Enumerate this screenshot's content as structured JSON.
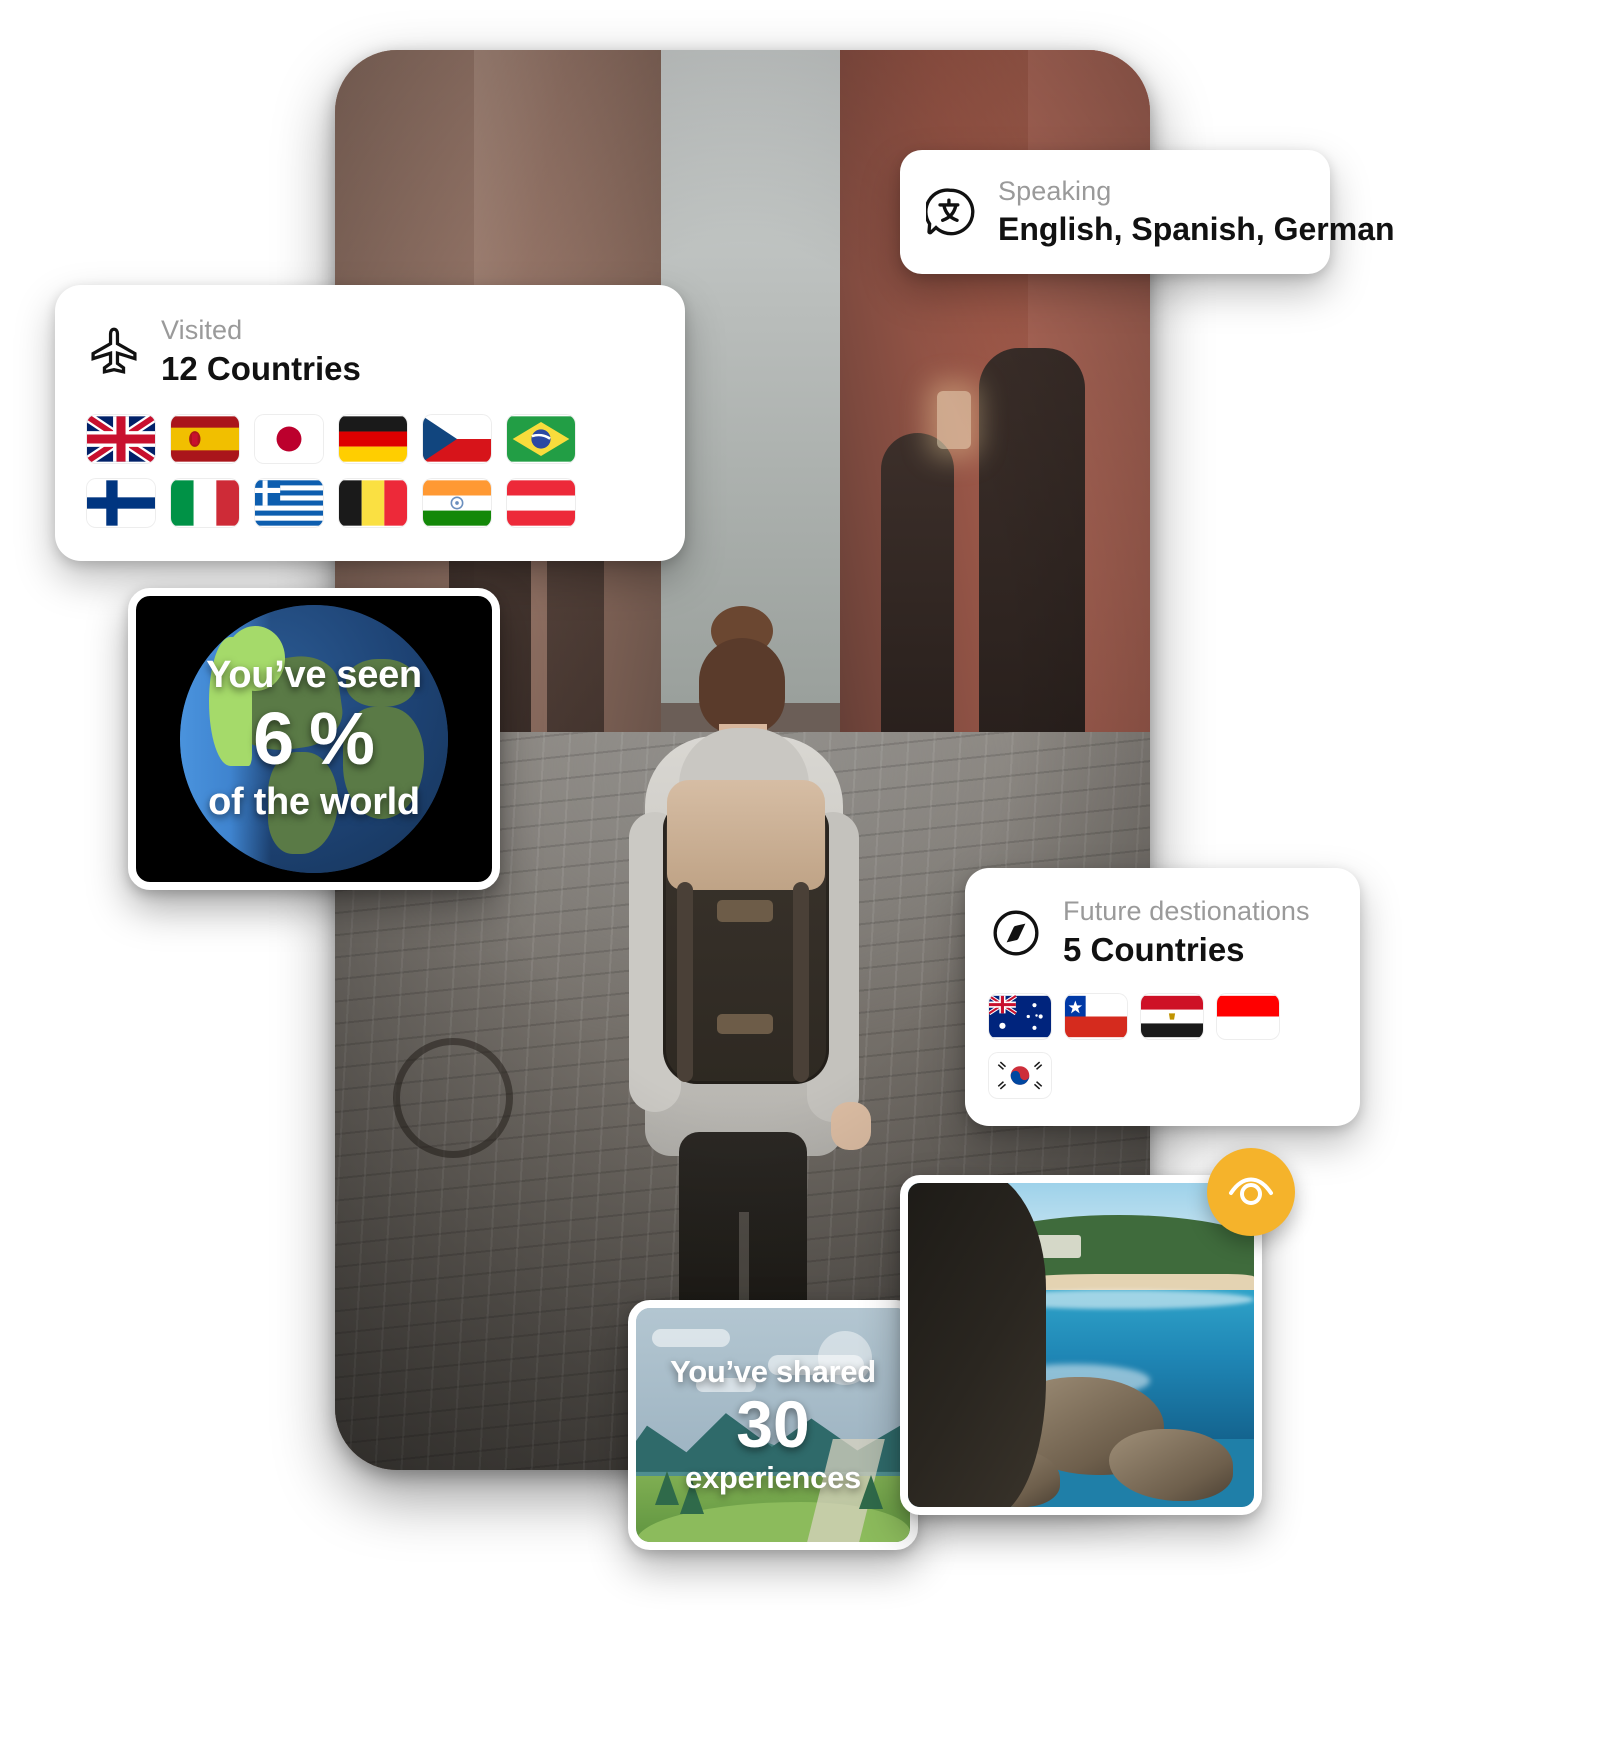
{
  "hero": {
    "name": "traveler-photo",
    "alt": "Woman with backpack walking down a narrow cobblestone European alley"
  },
  "speaking_card": {
    "icon": "translate-icon",
    "label": "Speaking",
    "value": "English, Spanish, German"
  },
  "visited_card": {
    "icon": "airplane-icon",
    "label": "Visited",
    "value": "12 Countries",
    "flags": [
      {
        "name": "United Kingdom",
        "code": "GB"
      },
      {
        "name": "Spain",
        "code": "ES"
      },
      {
        "name": "Japan",
        "code": "JP"
      },
      {
        "name": "Germany",
        "code": "DE"
      },
      {
        "name": "Czech Republic",
        "code": "CZ"
      },
      {
        "name": "Brazil",
        "code": "BR"
      },
      {
        "name": "Finland",
        "code": "FI"
      },
      {
        "name": "Italy",
        "code": "IT"
      },
      {
        "name": "Greece",
        "code": "GR"
      },
      {
        "name": "Belgium",
        "code": "BE"
      },
      {
        "name": "India",
        "code": "IN"
      },
      {
        "name": "Austria",
        "code": "AT"
      }
    ]
  },
  "future_card": {
    "icon": "compass-icon",
    "label": "Future destionations",
    "value": "5 Countries",
    "flags": [
      {
        "name": "Australia",
        "code": "AU"
      },
      {
        "name": "Chile",
        "code": "CL"
      },
      {
        "name": "Egypt",
        "code": "EG"
      },
      {
        "name": "Indonesia",
        "code": "ID"
      },
      {
        "name": "South Korea",
        "code": "KR"
      }
    ]
  },
  "globe_card": {
    "line1": "You’ve seen",
    "line2": "6 %",
    "line3": "of the world",
    "background": "#000000",
    "percent": 6
  },
  "shared_card": {
    "line1": "You’ve shared",
    "line2": "30",
    "line3": "experiences",
    "count": 30
  },
  "beach_card": {
    "name": "beach-photo",
    "alt": "Turquoise cove with rocks seen from a dark cave opening"
  },
  "eye_badge": {
    "icon": "eye-icon",
    "color": "#f5b32b"
  }
}
